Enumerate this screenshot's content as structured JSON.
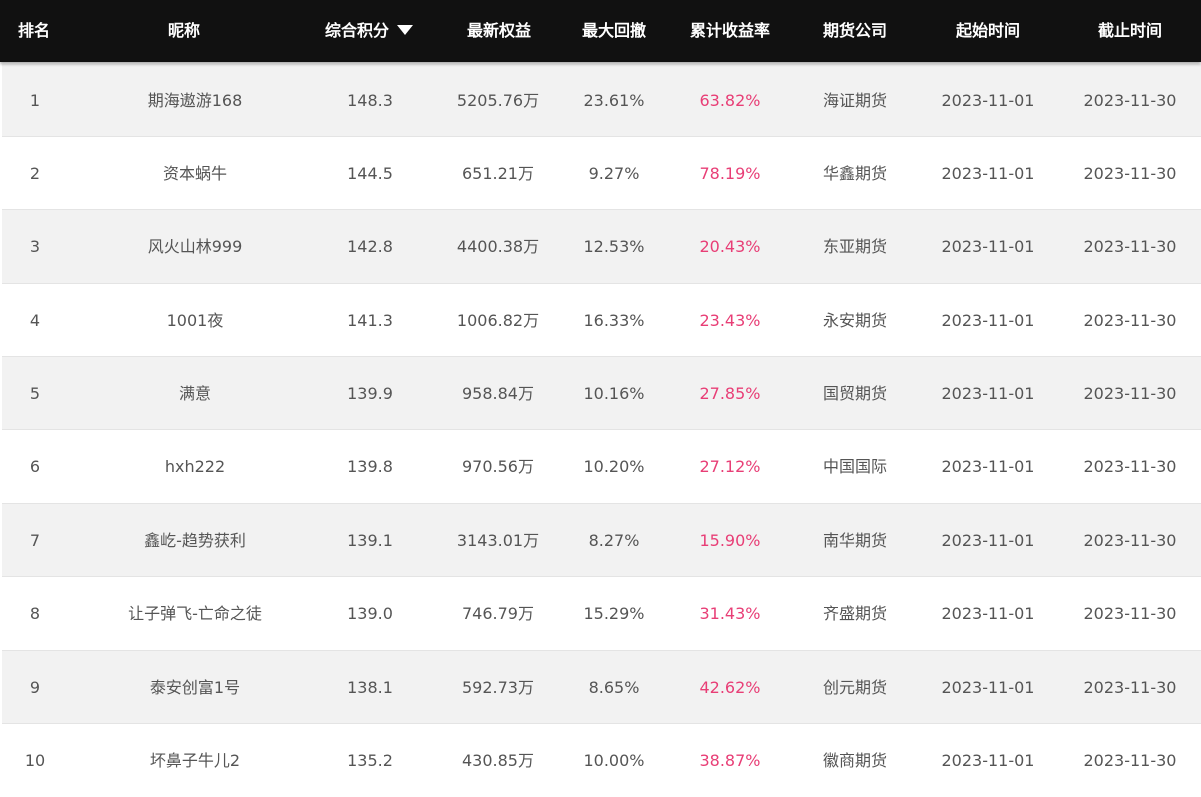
{
  "header": {
    "rank": "排名",
    "nickname": "昵称",
    "score": "综合积分",
    "equity": "最新权益",
    "drawdown": "最大回撤",
    "return_rate": "累计收益率",
    "broker": "期货公司",
    "start": "起始时间",
    "end": "截止时间",
    "sort_icon": "caret-down-icon"
  },
  "colors": {
    "header_bg": "#111111",
    "header_text": "#ffffff",
    "row_odd": "#f2f2f2",
    "row_even": "#ffffff",
    "body_text": "#555555",
    "return_rate": "#e83e76"
  },
  "rows": [
    {
      "rank": "1",
      "nickname": "期海遨游168",
      "score": "148.3",
      "equity": "5205.76万",
      "drawdown": "23.61%",
      "return_rate": "63.82%",
      "broker": "海证期货",
      "start": "2023-11-01",
      "end": "2023-11-30"
    },
    {
      "rank": "2",
      "nickname": "资本蜗牛",
      "score": "144.5",
      "equity": "651.21万",
      "drawdown": "9.27%",
      "return_rate": "78.19%",
      "broker": "华鑫期货",
      "start": "2023-11-01",
      "end": "2023-11-30"
    },
    {
      "rank": "3",
      "nickname": "风火山林999",
      "score": "142.8",
      "equity": "4400.38万",
      "drawdown": "12.53%",
      "return_rate": "20.43%",
      "broker": "东亚期货",
      "start": "2023-11-01",
      "end": "2023-11-30"
    },
    {
      "rank": "4",
      "nickname": "1001夜",
      "score": "141.3",
      "equity": "1006.82万",
      "drawdown": "16.33%",
      "return_rate": "23.43%",
      "broker": "永安期货",
      "start": "2023-11-01",
      "end": "2023-11-30"
    },
    {
      "rank": "5",
      "nickname": "满意",
      "score": "139.9",
      "equity": "958.84万",
      "drawdown": "10.16%",
      "return_rate": "27.85%",
      "broker": "国贸期货",
      "start": "2023-11-01",
      "end": "2023-11-30"
    },
    {
      "rank": "6",
      "nickname": "hxh222",
      "score": "139.8",
      "equity": "970.56万",
      "drawdown": "10.20%",
      "return_rate": "27.12%",
      "broker": "中国国际",
      "start": "2023-11-01",
      "end": "2023-11-30"
    },
    {
      "rank": "7",
      "nickname": "鑫屹-趋势获利",
      "score": "139.1",
      "equity": "3143.01万",
      "drawdown": "8.27%",
      "return_rate": "15.90%",
      "broker": "南华期货",
      "start": "2023-11-01",
      "end": "2023-11-30"
    },
    {
      "rank": "8",
      "nickname": "让子弹飞-亡命之徒",
      "score": "139.0",
      "equity": "746.79万",
      "drawdown": "15.29%",
      "return_rate": "31.43%",
      "broker": "齐盛期货",
      "start": "2023-11-01",
      "end": "2023-11-30"
    },
    {
      "rank": "9",
      "nickname": "泰安创富1号",
      "score": "138.1",
      "equity": "592.73万",
      "drawdown": "8.65%",
      "return_rate": "42.62%",
      "broker": "创元期货",
      "start": "2023-11-01",
      "end": "2023-11-30"
    },
    {
      "rank": "10",
      "nickname": "坏鼻子牛儿2",
      "score": "135.2",
      "equity": "430.85万",
      "drawdown": "10.00%",
      "return_rate": "38.87%",
      "broker": "徽商期货",
      "start": "2023-11-01",
      "end": "2023-11-30"
    }
  ]
}
